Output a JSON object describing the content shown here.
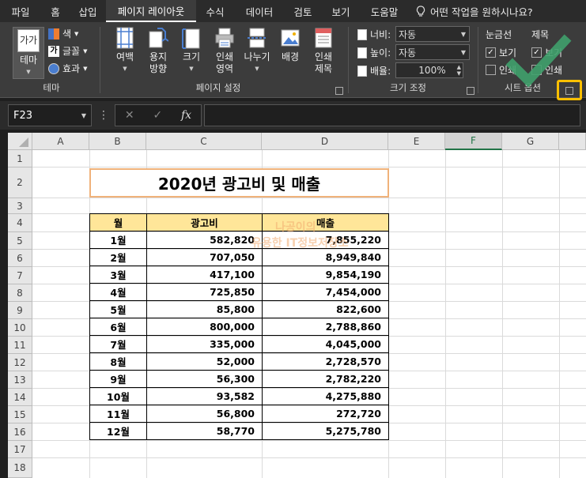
{
  "tabs": [
    "파일",
    "홈",
    "삽입",
    "페이지 레이아웃",
    "수식",
    "데이터",
    "검토",
    "보기",
    "도움말"
  ],
  "tell_me": "어떤 작업을 원하시나요?",
  "ribbon": {
    "theme": {
      "button": "테마",
      "color": "색",
      "font": "글꼴",
      "effect": "효과",
      "group": "테마"
    },
    "page_setup": {
      "margins": "여백",
      "orientation1": "용지",
      "orientation2": "방향",
      "size": "크기",
      "print_area1": "인쇄",
      "print_area2": "영역",
      "breaks": "나누기",
      "background": "배경",
      "print_titles1": "인쇄",
      "print_titles2": "제목",
      "group": "페이지 설정"
    },
    "scale": {
      "width_label": "너비:",
      "width_value": "자동",
      "height_label": "높이:",
      "height_value": "자동",
      "scale_label": "배율:",
      "scale_value": "100%",
      "group": "크기 조정"
    },
    "sheet_options": {
      "gridlines": "눈금선",
      "headings": "제목",
      "view": "보기",
      "print": "인쇄",
      "view2": "보기",
      "print2": "인쇄",
      "group": "시트 옵션"
    }
  },
  "formula_bar": {
    "name_box": "F23",
    "fx": "fx",
    "value": ""
  },
  "columns": [
    "A",
    "B",
    "C",
    "D",
    "E",
    "F",
    "G"
  ],
  "selected_column": "F",
  "rows": [
    "1",
    "2",
    "3",
    "4",
    "5",
    "6",
    "7",
    "8",
    "9",
    "10",
    "11",
    "12",
    "13",
    "14",
    "15",
    "16",
    "17",
    "18"
  ],
  "sheet": {
    "title": "2020년 광고비 및 매출",
    "headers": [
      "월",
      "광고비",
      "매출"
    ],
    "data": [
      [
        "1월",
        "582,820",
        "7,855,220"
      ],
      [
        "2월",
        "707,050",
        "8,949,840"
      ],
      [
        "3월",
        "417,100",
        "9,854,190"
      ],
      [
        "4월",
        "725,850",
        "7,454,000"
      ],
      [
        "5월",
        "85,800",
        "822,600"
      ],
      [
        "6월",
        "800,000",
        "2,788,860"
      ],
      [
        "7월",
        "335,000",
        "4,045,000"
      ],
      [
        "8월",
        "52,000",
        "2,728,570"
      ],
      [
        "9월",
        "56,300",
        "2,782,220"
      ],
      [
        "10월",
        "93,582",
        "4,275,880"
      ],
      [
        "11월",
        "56,800",
        "272,720"
      ],
      [
        "12월",
        "58,770",
        "5,275,780"
      ]
    ]
  },
  "watermark": [
    "나공이의",
    "유용한 IT정보저장소"
  ],
  "colors": {
    "accent": "#217346",
    "header_fill": "#ffe699",
    "title_border": "#f0b27a",
    "highlight": "#ffc000",
    "check": "#3fa06b"
  }
}
